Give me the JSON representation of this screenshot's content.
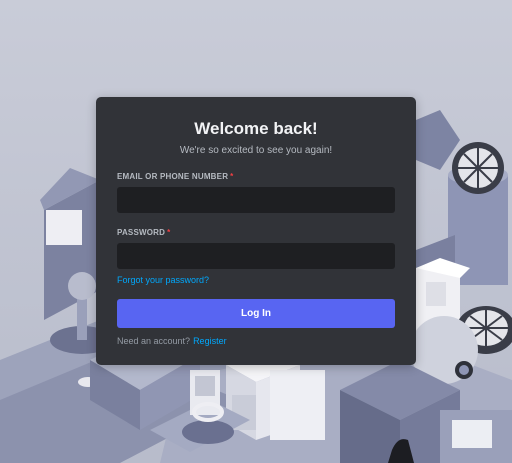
{
  "login": {
    "title": "Welcome back!",
    "subtitle": "We're so excited to see you again!",
    "email_label": "EMAIL OR PHONE NUMBER",
    "password_label": "PASSWORD",
    "required_marker": "*",
    "email_value": "",
    "password_value": "",
    "forgot_link": "Forgot your password?",
    "login_button": "Log In",
    "need_account": "Need an account?",
    "register_link": "Register"
  },
  "colors": {
    "brand": "#5865f2",
    "link": "#00a8fc",
    "card_bg": "#313338",
    "input_bg": "#1e1f22",
    "required": "#f23f43"
  }
}
